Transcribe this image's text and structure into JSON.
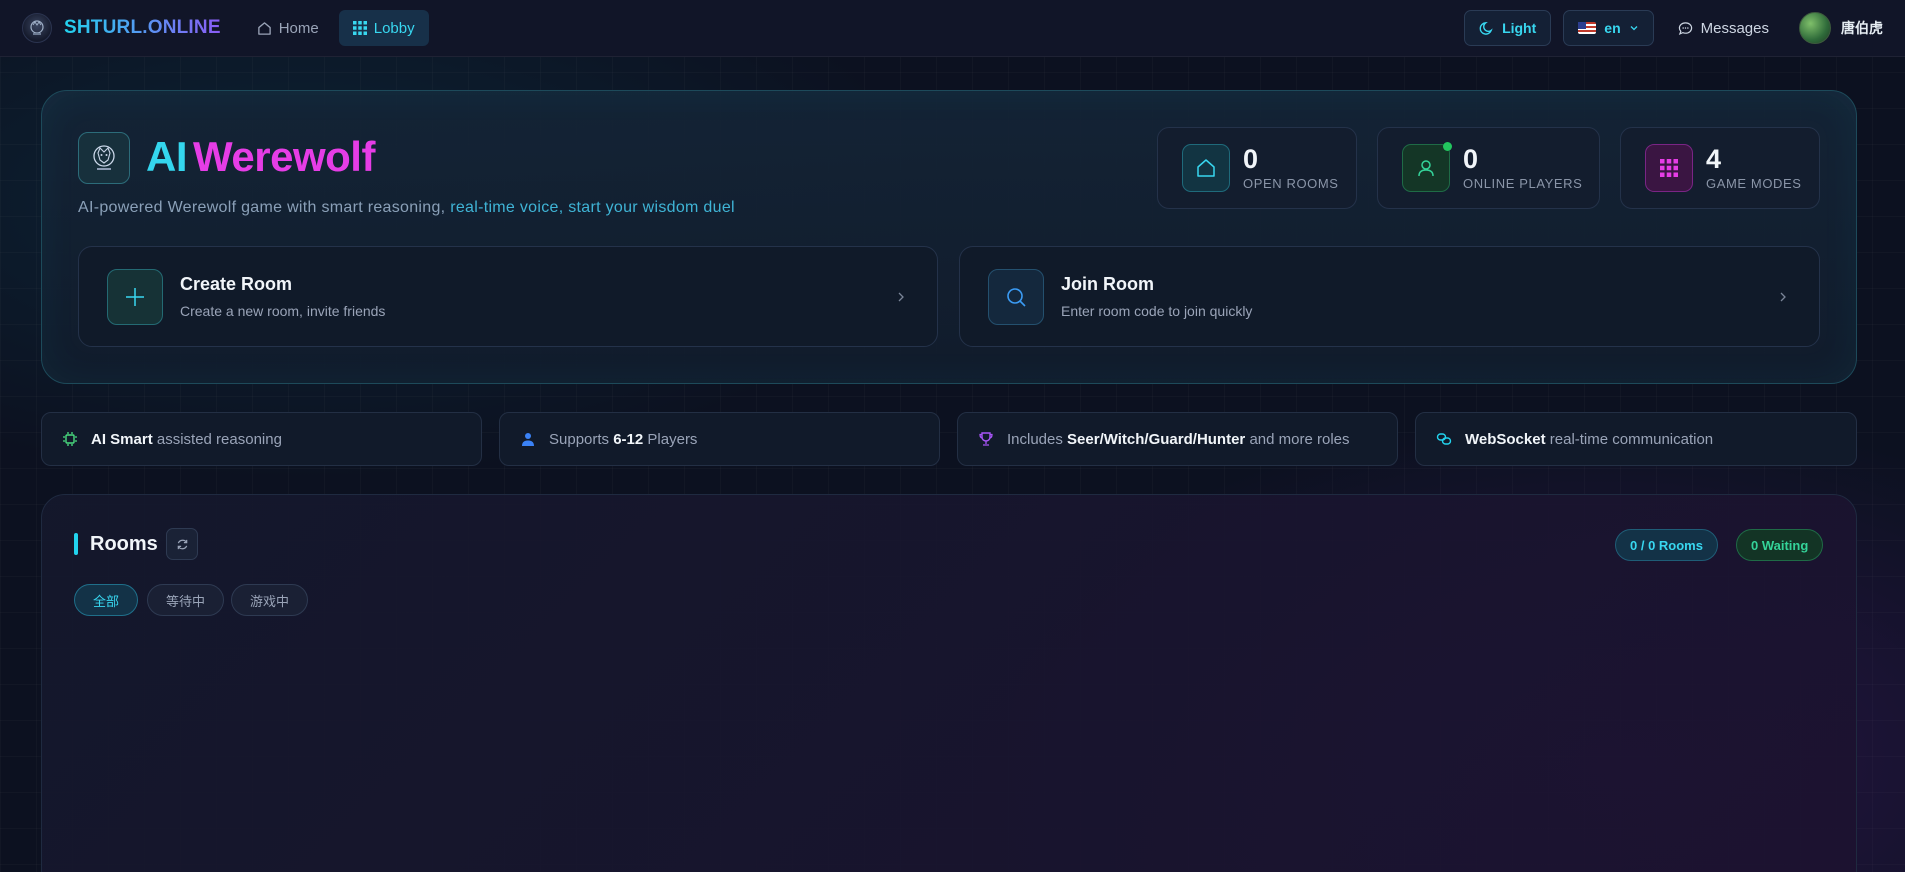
{
  "nav": {
    "brand": "SHTURL.ONLINE",
    "home": "Home",
    "lobby": "Lobby",
    "theme": "Light",
    "lang": "en",
    "messages": "Messages",
    "username": "唐伯虎"
  },
  "hero": {
    "title_ai": "AI",
    "title_wolf": "Werewolf",
    "subtitle_a": "AI-powered Werewolf game with smart reasoning, ",
    "subtitle_b": "real-time voice, start your wisdom duel",
    "stats": [
      {
        "value": "0",
        "label": "OPEN ROOMS"
      },
      {
        "value": "0",
        "label": "ONLINE PLAYERS"
      },
      {
        "value": "4",
        "label": "GAME MODES"
      }
    ],
    "create": {
      "title": "Create Room",
      "desc": "Create a new room, invite friends"
    },
    "join": {
      "title": "Join Room",
      "desc": "Enter room code to join quickly"
    }
  },
  "features": [
    {
      "strong": "AI Smart",
      "pre": "",
      "post": " assisted reasoning"
    },
    {
      "pre": "Supports ",
      "strong": "6-12",
      "post": " Players"
    },
    {
      "pre": "Includes ",
      "strong": "Seer/Witch/Guard/Hunter",
      "post": " and more roles"
    },
    {
      "pre": "",
      "strong": "WebSocket",
      "post": " real-time communication"
    }
  ],
  "rooms": {
    "title": "Rooms",
    "count_badge": "0 / 0 Rooms",
    "waiting_badge": "0 Waiting",
    "filters": [
      "全部",
      "等待中",
      "游戏中"
    ]
  },
  "colors": {
    "accent": "#22d3ee",
    "pink": "#e63de6",
    "green": "#22c55e"
  }
}
